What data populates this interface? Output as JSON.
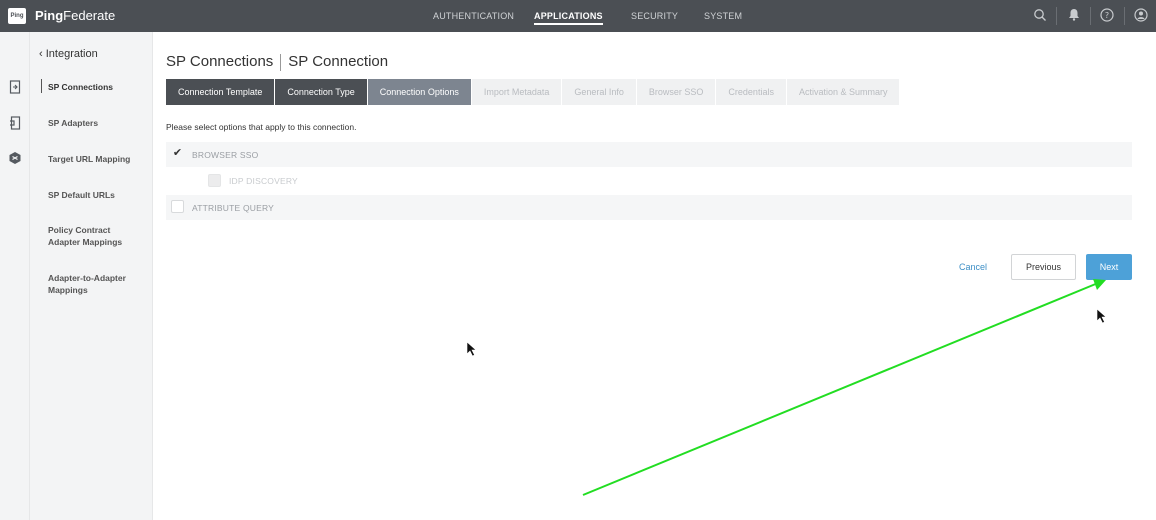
{
  "app": {
    "logo_text": "Ping",
    "brand_bold": "Ping",
    "brand_rest": "Federate"
  },
  "topnav": [
    {
      "label": "AUTHENTICATION",
      "active": false
    },
    {
      "label": "APPLICATIONS",
      "active": true
    },
    {
      "label": "SECURITY",
      "active": false
    },
    {
      "label": "SYSTEM",
      "active": false
    }
  ],
  "top_icons": [
    "search-icon",
    "bell-icon",
    "help-icon",
    "user-icon"
  ],
  "rail_icons": [
    "connections-icon",
    "adapters-icon",
    "mapping-icon"
  ],
  "sidenav": {
    "back_label": "Integration",
    "items": [
      "SP Connections",
      "SP Adapters",
      "Target URL Mapping",
      "SP Default URLs",
      "Policy Contract Adapter Mappings",
      "Adapter-to-Adapter Mappings"
    ]
  },
  "page": {
    "title_part1": "SP Connections",
    "title_part2": "SP Connection"
  },
  "wizard": {
    "steps": [
      {
        "label": "Connection Template",
        "state": "done"
      },
      {
        "label": "Connection Type",
        "state": "done"
      },
      {
        "label": "Connection Options",
        "state": "current"
      },
      {
        "label": "Import Metadata",
        "state": "todo"
      },
      {
        "label": "General Info",
        "state": "todo"
      },
      {
        "label": "Browser SSO",
        "state": "todo"
      },
      {
        "label": "Credentials",
        "state": "todo"
      },
      {
        "label": "Activation & Summary",
        "state": "todo"
      }
    ]
  },
  "options": {
    "prompt": "Please select options that apply to this connection.",
    "browser_sso": {
      "label": "BROWSER SSO",
      "checked": true
    },
    "idp_discovery": {
      "label": "IDP DISCOVERY",
      "checked": false,
      "disabled": true
    },
    "attribute_query": {
      "label": "ATTRIBUTE QUERY",
      "checked": false
    }
  },
  "buttons": {
    "cancel": "Cancel",
    "previous": "Previous",
    "next": "Next"
  },
  "colors": {
    "topbar": "#4b4f54",
    "accent": "#4da1d8",
    "annotation_arrow": "#22dd22"
  }
}
